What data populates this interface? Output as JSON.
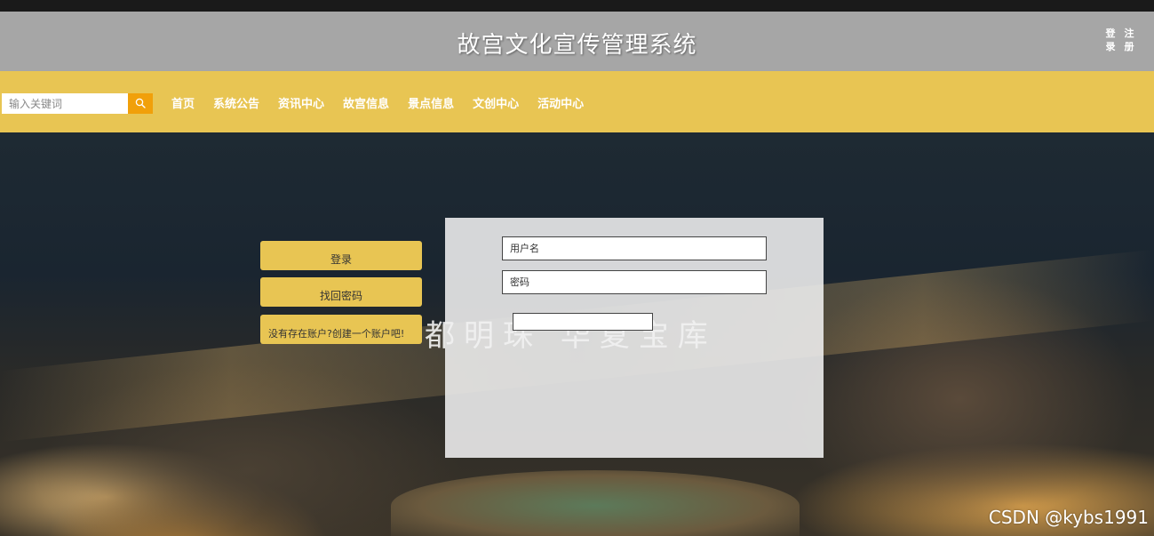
{
  "header": {
    "title": "故宫文化宣传管理系统",
    "login_label": "登录",
    "register_label": "注册"
  },
  "search": {
    "placeholder": "输入关键词"
  },
  "nav": {
    "items": [
      "首页",
      "系统公告",
      "资讯中心",
      "故宫信息",
      "景点信息",
      "文创中心",
      "活动中心"
    ]
  },
  "side_buttons": {
    "login": "登录",
    "forgot_password": "找回密码",
    "create_account": "没有存在账户?创建一个账户吧!"
  },
  "login_form": {
    "username_placeholder": "用户名",
    "password_placeholder": "密码"
  },
  "banner_text": "都明珠 华夏宝库",
  "watermark": "CSDN @kybs1991",
  "colors": {
    "header_bg": "#a6a6a6",
    "nav_bg": "#e8c553",
    "search_button": "#f1a00a",
    "button_bg": "#e8c553"
  }
}
